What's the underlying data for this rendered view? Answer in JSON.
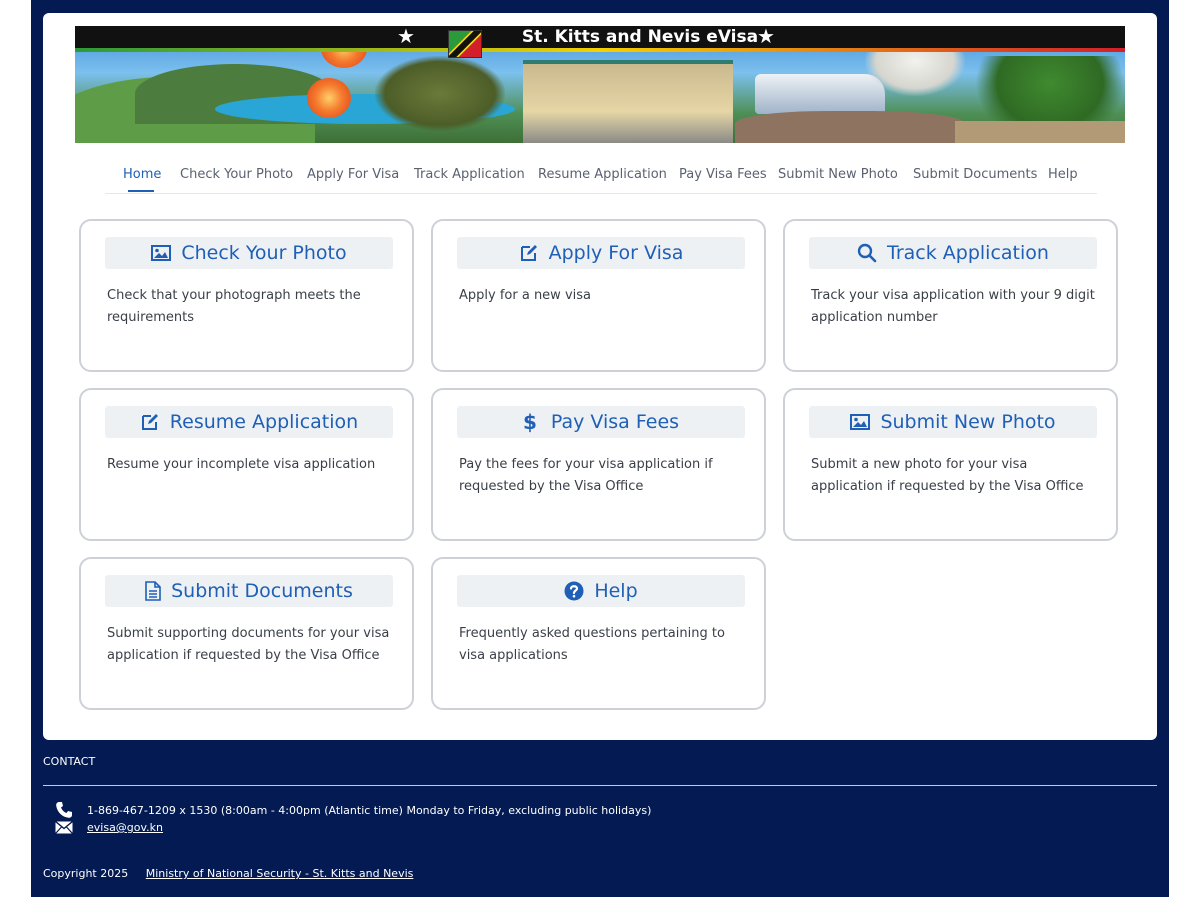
{
  "banner": {
    "title": "St. Kitts and Nevis eVisa",
    "star_left": "★",
    "star_right": "★"
  },
  "nav": {
    "items": [
      {
        "label": "Home"
      },
      {
        "label": "Check Your Photo"
      },
      {
        "label": "Apply For Visa"
      },
      {
        "label": "Track Application"
      },
      {
        "label": "Resume Application"
      },
      {
        "label": "Pay Visa Fees"
      },
      {
        "label": "Submit New Photo"
      },
      {
        "label": "Submit Documents"
      },
      {
        "label": "Help"
      }
    ],
    "active": "Home"
  },
  "cards": [
    {
      "title": "Check Your Photo",
      "icon": "image-icon",
      "desc": "Check that your photograph meets the requirements"
    },
    {
      "title": "Apply For Visa",
      "icon": "edit-icon",
      "desc": "Apply for a new visa"
    },
    {
      "title": "Track Application",
      "icon": "search-icon",
      "desc": "Track your visa application with your 9 digit application number"
    },
    {
      "title": "Resume Application",
      "icon": "edit-icon",
      "desc": "Resume your incomplete visa application"
    },
    {
      "title": "Pay Visa Fees",
      "icon": "dollar-icon",
      "desc": "Pay the fees for your visa application if requested by the Visa Office"
    },
    {
      "title": "Submit New Photo",
      "icon": "image-icon",
      "desc": "Submit a new photo for your visa application if requested by the Visa Office"
    },
    {
      "title": "Submit Documents",
      "icon": "document-icon",
      "desc": "Submit supporting documents for your visa application if requested by the Visa Office"
    },
    {
      "title": "Help",
      "icon": "help-icon",
      "desc": "Frequently asked questions pertaining to visa applications"
    }
  ],
  "footer": {
    "contact_title": "CONTACT",
    "phone": "1-869-467-1209 x 1530 (8:00am - 4:00pm (Atlantic time) Monday to Friday, excluding public holidays)",
    "email": "evisa@gov.kn",
    "copyright": "Copyright 2025",
    "ministry_link": "Ministry of National Security - St. Kitts and Nevis"
  },
  "colors": {
    "navy": "#031a52",
    "accent": "#1f5fb6",
    "card_border": "#cdd1d7"
  }
}
